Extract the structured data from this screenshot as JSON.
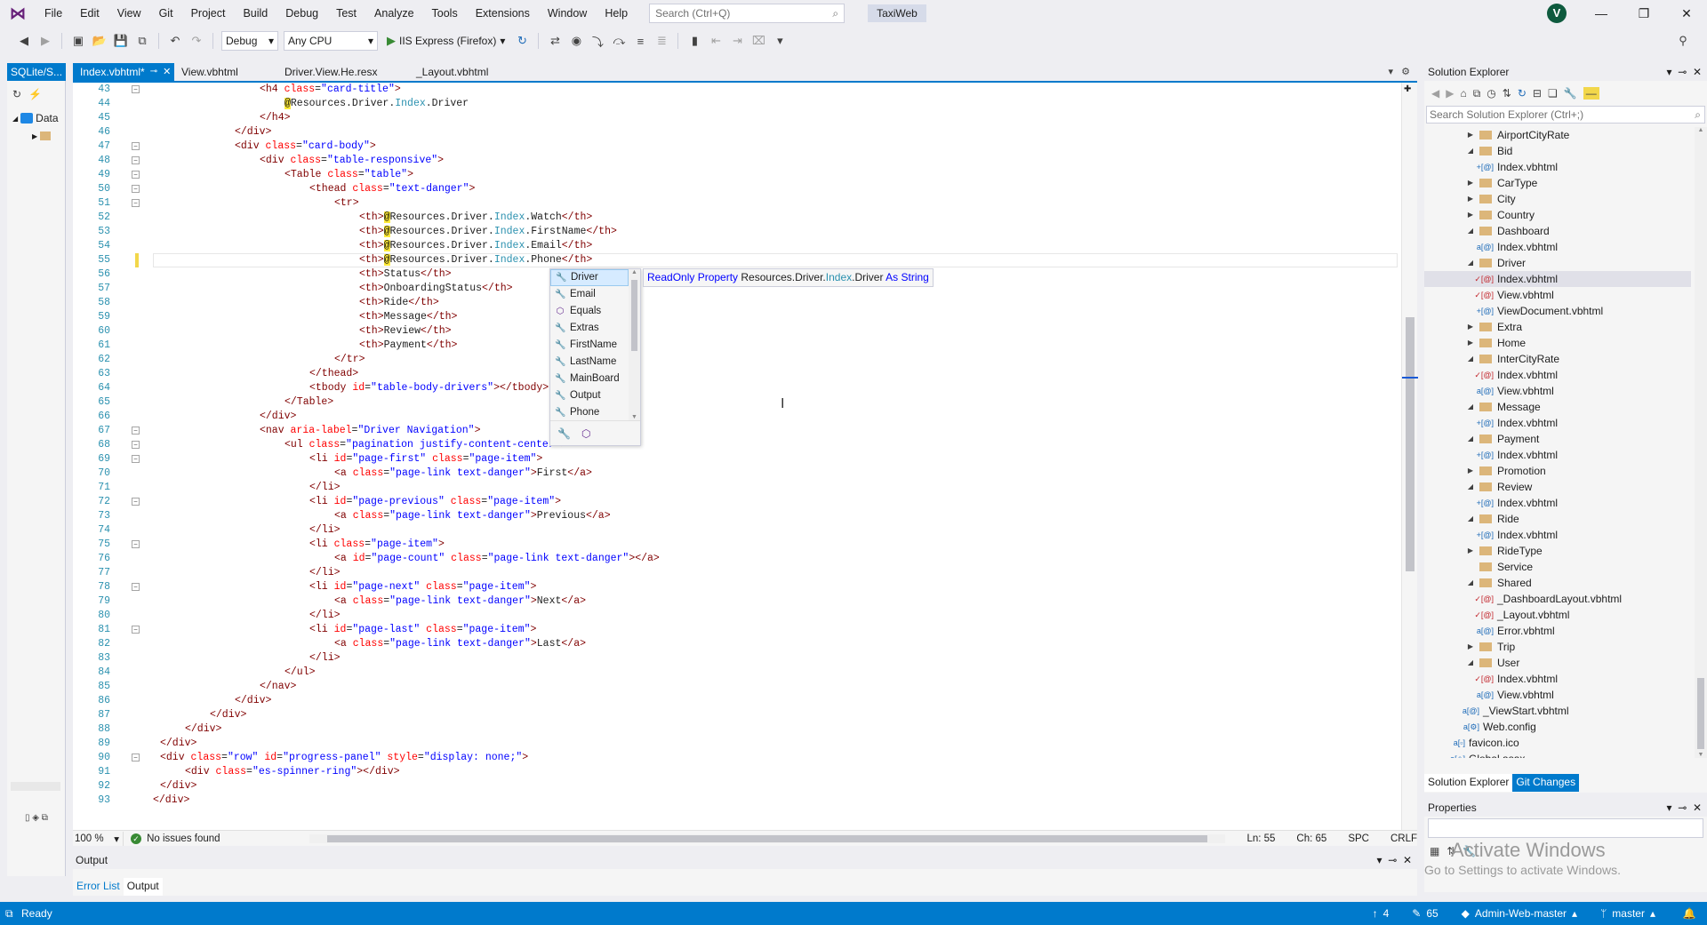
{
  "menu": {
    "items": [
      "File",
      "Edit",
      "View",
      "Git",
      "Project",
      "Build",
      "Debug",
      "Test",
      "Analyze",
      "Tools",
      "Extensions",
      "Window",
      "Help"
    ],
    "search_placeholder": "Search (Ctrl+Q)",
    "solution_name": "TaxiWeb",
    "avatar_initial": "V"
  },
  "toolbar": {
    "config": "Debug",
    "platform": "Any CPU",
    "run_target": "IIS Express (Firefox)"
  },
  "left_panel": {
    "tab": "SQLite/S...",
    "tree_root": "Data"
  },
  "tabs": [
    {
      "label": "Index.vbhtml*",
      "active": true
    },
    {
      "label": "View.vbhtml",
      "active": false
    },
    {
      "label": "Driver.View.He.resx",
      "active": false
    },
    {
      "label": "_Layout.vbhtml",
      "active": false
    }
  ],
  "code": {
    "lines": [
      {
        "n": "43",
        "ind": 5,
        "html": "<span class='t'>&lt;h4</span> <span class='a'>class</span>=<span class='v'>\"card-title\"</span><span class='t'>&gt;</span>"
      },
      {
        "n": "44",
        "ind": 6,
        "html": "<span class='at'>@</span>Resources.Driver.<span class='cls'>Index</span>.Driver"
      },
      {
        "n": "45",
        "ind": 5,
        "html": "<span class='t'>&lt;/h4&gt;</span>"
      },
      {
        "n": "46",
        "ind": 4,
        "html": "<span class='t'>&lt;/div&gt;</span>"
      },
      {
        "n": "47",
        "ind": 4,
        "html": "<span class='t'>&lt;div</span> <span class='a'>class</span>=<span class='v'>\"card-body\"</span><span class='t'>&gt;</span>"
      },
      {
        "n": "48",
        "ind": 5,
        "html": "<span class='t'>&lt;div</span> <span class='a'>class</span>=<span class='v'>\"table-responsive\"</span><span class='t'>&gt;</span>"
      },
      {
        "n": "49",
        "ind": 6,
        "html": "<span class='t'>&lt;Table</span> <span class='a'>class</span>=<span class='v'>\"table\"</span><span class='t'>&gt;</span>"
      },
      {
        "n": "50",
        "ind": 7,
        "html": "<span class='t'>&lt;thead</span> <span class='a'>class</span>=<span class='v'>\"text-danger\"</span><span class='t'>&gt;</span>"
      },
      {
        "n": "51",
        "ind": 8,
        "html": "<span class='t'>&lt;tr&gt;</span>"
      },
      {
        "n": "52",
        "ind": 9,
        "html": "<span class='t'>&lt;th&gt;</span><span class='at'>@</span>Resources.Driver.<span class='cls'>Index</span>.Watch<span class='t'>&lt;/th&gt;</span>"
      },
      {
        "n": "53",
        "ind": 9,
        "html": "<span class='t'>&lt;th&gt;</span><span class='at'>@</span>Resources.Driver.<span class='cls'>Index</span>.FirstName<span class='t'>&lt;/th&gt;</span>"
      },
      {
        "n": "54",
        "ind": 9,
        "html": "<span class='t'>&lt;th&gt;</span><span class='at'>@</span>Resources.Driver.<span class='cls'>Index</span>.Email<span class='t'>&lt;/th&gt;</span>"
      },
      {
        "n": "55",
        "ind": 9,
        "html": "<span class='t'>&lt;th&gt;</span><span class='at'>@</span>Resources.Driver.<span class='cls'>Index</span>.Phone<span class='t'>&lt;/th&gt;</span>"
      },
      {
        "n": "56",
        "ind": 9,
        "html": "<span class='t'>&lt;th&gt;</span>Status<span class='t'>&lt;/th&gt;</span>"
      },
      {
        "n": "57",
        "ind": 9,
        "html": "<span class='t'>&lt;th&gt;</span>OnboardingStatus<span class='t'>&lt;/th&gt;</span>"
      },
      {
        "n": "58",
        "ind": 9,
        "html": "<span class='t'>&lt;th&gt;</span>Ride<span class='t'>&lt;/th&gt;</span>"
      },
      {
        "n": "59",
        "ind": 9,
        "html": "<span class='t'>&lt;th&gt;</span>Message<span class='t'>&lt;/th&gt;</span>"
      },
      {
        "n": "60",
        "ind": 9,
        "html": "<span class='t'>&lt;th&gt;</span>Review<span class='t'>&lt;/th&gt;</span>"
      },
      {
        "n": "61",
        "ind": 9,
        "html": "<span class='t'>&lt;th&gt;</span>Payment<span class='t'>&lt;/th&gt;</span>"
      },
      {
        "n": "62",
        "ind": 8,
        "html": "<span class='t'>&lt;/tr&gt;</span>"
      },
      {
        "n": "63",
        "ind": 7,
        "html": "<span class='t'>&lt;/thead&gt;</span>"
      },
      {
        "n": "64",
        "ind": 7,
        "html": "<span class='t'>&lt;tbody</span> <span class='a'>id</span>=<span class='v'>\"table-body-drivers\"</span><span class='t'>&gt;&lt;/tbody&gt;</span>"
      },
      {
        "n": "65",
        "ind": 6,
        "html": "<span class='t'>&lt;/Table&gt;</span>"
      },
      {
        "n": "66",
        "ind": 5,
        "html": "<span class='t'>&lt;/div&gt;</span>"
      },
      {
        "n": "67",
        "ind": 5,
        "html": "<span class='t'>&lt;nav</span> <span class='a'>aria-label</span>=<span class='v'>\"Driver Navigation\"</span><span class='t'>&gt;</span>"
      },
      {
        "n": "68",
        "ind": 6,
        "html": "<span class='t'>&lt;ul</span> <span class='a'>class</span>=<span class='v'>\"pagination justify-content-center\"</span><span class='t'>&gt;</span>"
      },
      {
        "n": "69",
        "ind": 7,
        "html": "<span class='t'>&lt;li</span> <span class='a'>id</span>=<span class='v'>\"page-first\"</span> <span class='a'>class</span>=<span class='v'>\"page-item\"</span><span class='t'>&gt;</span>"
      },
      {
        "n": "70",
        "ind": 8,
        "html": "<span class='t'>&lt;a</span> <span class='a'>class</span>=<span class='v'>\"page-link text-danger\"</span><span class='t'>&gt;</span>First<span class='t'>&lt;/a&gt;</span>"
      },
      {
        "n": "71",
        "ind": 7,
        "html": "<span class='t'>&lt;/li&gt;</span>"
      },
      {
        "n": "72",
        "ind": 7,
        "html": "<span class='t'>&lt;li</span> <span class='a'>id</span>=<span class='v'>\"page-previous\"</span> <span class='a'>class</span>=<span class='v'>\"page-item\"</span><span class='t'>&gt;</span>"
      },
      {
        "n": "73",
        "ind": 8,
        "html": "<span class='t'>&lt;a</span> <span class='a'>class</span>=<span class='v'>\"page-link text-danger\"</span><span class='t'>&gt;</span>Previous<span class='t'>&lt;/a&gt;</span>"
      },
      {
        "n": "74",
        "ind": 7,
        "html": "<span class='t'>&lt;/li&gt;</span>"
      },
      {
        "n": "75",
        "ind": 7,
        "html": "<span class='t'>&lt;li</span> <span class='a'>class</span>=<span class='v'>\"page-item\"</span><span class='t'>&gt;</span>"
      },
      {
        "n": "76",
        "ind": 8,
        "html": "<span class='t'>&lt;a</span> <span class='a'>id</span>=<span class='v'>\"page-count\"</span> <span class='a'>class</span>=<span class='v'>\"page-link text-danger\"</span><span class='t'>&gt;&lt;/a&gt;</span>"
      },
      {
        "n": "77",
        "ind": 7,
        "html": "<span class='t'>&lt;/li&gt;</span>"
      },
      {
        "n": "78",
        "ind": 7,
        "html": "<span class='t'>&lt;li</span> <span class='a'>id</span>=<span class='v'>\"page-next\"</span> <span class='a'>class</span>=<span class='v'>\"page-item\"</span><span class='t'>&gt;</span>"
      },
      {
        "n": "79",
        "ind": 8,
        "html": "<span class='t'>&lt;a</span> <span class='a'>class</span>=<span class='v'>\"page-link text-danger\"</span><span class='t'>&gt;</span>Next<span class='t'>&lt;/a&gt;</span>"
      },
      {
        "n": "80",
        "ind": 7,
        "html": "<span class='t'>&lt;/li&gt;</span>"
      },
      {
        "n": "81",
        "ind": 7,
        "html": "<span class='t'>&lt;li</span> <span class='a'>id</span>=<span class='v'>\"page-last\"</span> <span class='a'>class</span>=<span class='v'>\"page-item\"</span><span class='t'>&gt;</span>"
      },
      {
        "n": "82",
        "ind": 8,
        "html": "<span class='t'>&lt;a</span> <span class='a'>class</span>=<span class='v'>\"page-link text-danger\"</span><span class='t'>&gt;</span>Last<span class='t'>&lt;/a&gt;</span>"
      },
      {
        "n": "83",
        "ind": 7,
        "html": "<span class='t'>&lt;/li&gt;</span>"
      },
      {
        "n": "84",
        "ind": 6,
        "html": "<span class='t'>&lt;/ul&gt;</span>"
      },
      {
        "n": "85",
        "ind": 5,
        "html": "<span class='t'>&lt;/nav&gt;</span>"
      },
      {
        "n": "86",
        "ind": 4,
        "html": "<span class='t'>&lt;/div&gt;</span>"
      },
      {
        "n": "87",
        "ind": 3,
        "html": "<span class='t'>&lt;/div&gt;</span>"
      },
      {
        "n": "88",
        "ind": 2,
        "html": "<span class='t'>&lt;/div&gt;</span>"
      },
      {
        "n": "89",
        "ind": 1,
        "html": "<span class='t'>&lt;/div&gt;</span>"
      },
      {
        "n": "90",
        "ind": 1,
        "html": "<span class='t'>&lt;div</span> <span class='a'>class</span>=<span class='v'>\"row\"</span> <span class='a'>id</span>=<span class='v'>\"progress-panel\"</span> <span class='a'>style</span>=<span class='v'>\"display: none;\"</span><span class='t'>&gt;</span>"
      },
      {
        "n": "91",
        "ind": 2,
        "html": "<span class='t'>&lt;div</span> <span class='a'>class</span>=<span class='v'>\"es-spinner-ring\"</span><span class='t'>&gt;&lt;/div&gt;</span>"
      },
      {
        "n": "92",
        "ind": 1,
        "html": "<span class='t'>&lt;/div&gt;</span>"
      },
      {
        "n": "93",
        "ind": 0,
        "html": "<span class='t'>&lt;/div&gt;</span>"
      }
    ],
    "fold_lines": [
      "43",
      "47",
      "48",
      "49",
      "50",
      "51",
      "67",
      "68",
      "69",
      "72",
      "75",
      "78",
      "81",
      "90"
    ]
  },
  "completion": {
    "items": [
      "Driver",
      "Email",
      "Equals",
      "Extras",
      "FirstName",
      "LastName",
      "MainBoard",
      "Output",
      "Phone"
    ],
    "selected": "Driver",
    "tooltip_kw": "ReadOnly Property",
    "tooltip_pre": "Resources.Driver.",
    "tooltip_cls": "Index",
    "tooltip_post": ".Driver",
    "tooltip_as": "As",
    "tooltip_type": "String"
  },
  "editor_status": {
    "zoom": "100 %",
    "issues": "No issues found",
    "line": "Ln: 55",
    "col": "Ch: 65",
    "spc": "SPC",
    "eol": "CRLF"
  },
  "output": {
    "title": "Output",
    "tabs": [
      "Error List",
      "Output"
    ]
  },
  "solution_explorer": {
    "title": "Solution Explorer",
    "search_placeholder": "Search Solution Explorer (Ctrl+;)",
    "tabs": [
      "Solution Explorer",
      "Git Changes"
    ],
    "tree": [
      {
        "label": "AirportCityRate",
        "kind": "folder",
        "level": 0,
        "exp": "▶"
      },
      {
        "label": "Bid",
        "kind": "folder",
        "level": 0,
        "exp": "◢"
      },
      {
        "label": "Index.vbhtml",
        "kind": "file",
        "level": 1,
        "mark": "+[@]"
      },
      {
        "label": "CarType",
        "kind": "folder",
        "level": 0,
        "exp": "▶"
      },
      {
        "label": "City",
        "kind": "folder",
        "level": 0,
        "exp": "▶"
      },
      {
        "label": "Country",
        "kind": "folder",
        "level": 0,
        "exp": "▶"
      },
      {
        "label": "Dashboard",
        "kind": "folder",
        "level": 0,
        "exp": "◢"
      },
      {
        "label": "Index.vbhtml",
        "kind": "file",
        "level": 1,
        "mark": "a[@]"
      },
      {
        "label": "Driver",
        "kind": "folder",
        "level": 0,
        "exp": "◢"
      },
      {
        "label": "Index.vbhtml",
        "kind": "file",
        "level": 1,
        "mark": "✓[@]",
        "mod": true,
        "sel": true
      },
      {
        "label": "View.vbhtml",
        "kind": "file",
        "level": 1,
        "mark": "✓[@]",
        "mod": true
      },
      {
        "label": "ViewDocument.vbhtml",
        "kind": "file",
        "level": 1,
        "mark": "+[@]"
      },
      {
        "label": "Extra",
        "kind": "folder",
        "level": 0,
        "exp": "▶"
      },
      {
        "label": "Home",
        "kind": "folder",
        "level": 0,
        "exp": "▶"
      },
      {
        "label": "InterCityRate",
        "kind": "folder",
        "level": 0,
        "exp": "◢"
      },
      {
        "label": "Index.vbhtml",
        "kind": "file",
        "level": 1,
        "mark": "✓[@]",
        "mod": true
      },
      {
        "label": "View.vbhtml",
        "kind": "file",
        "level": 1,
        "mark": "a[@]"
      },
      {
        "label": "Message",
        "kind": "folder",
        "level": 0,
        "exp": "◢"
      },
      {
        "label": "Index.vbhtml",
        "kind": "file",
        "level": 1,
        "mark": "+[@]"
      },
      {
        "label": "Payment",
        "kind": "folder",
        "level": 0,
        "exp": "◢"
      },
      {
        "label": "Index.vbhtml",
        "kind": "file",
        "level": 1,
        "mark": "+[@]"
      },
      {
        "label": "Promotion",
        "kind": "folder",
        "level": 0,
        "exp": "▶"
      },
      {
        "label": "Review",
        "kind": "folder",
        "level": 0,
        "exp": "◢"
      },
      {
        "label": "Index.vbhtml",
        "kind": "file",
        "level": 1,
        "mark": "+[@]"
      },
      {
        "label": "Ride",
        "kind": "folder",
        "level": 0,
        "exp": "◢"
      },
      {
        "label": "Index.vbhtml",
        "kind": "file",
        "level": 1,
        "mark": "+[@]"
      },
      {
        "label": "RideType",
        "kind": "folder",
        "level": 0,
        "exp": "▶"
      },
      {
        "label": "Service",
        "kind": "folder",
        "level": 0,
        "exp": ""
      },
      {
        "label": "Shared",
        "kind": "folder",
        "level": 0,
        "exp": "◢"
      },
      {
        "label": "_DashboardLayout.vbhtml",
        "kind": "file",
        "level": 1,
        "mark": "✓[@]",
        "mod": true
      },
      {
        "label": "_Layout.vbhtml",
        "kind": "file",
        "level": 1,
        "mark": "✓[@]",
        "mod": true
      },
      {
        "label": "Error.vbhtml",
        "kind": "file",
        "level": 1,
        "mark": "a[@]"
      },
      {
        "label": "Trip",
        "kind": "folder",
        "level": 0,
        "exp": "▶"
      },
      {
        "label": "User",
        "kind": "folder",
        "level": 0,
        "exp": "◢"
      },
      {
        "label": "Index.vbhtml",
        "kind": "file",
        "level": 1,
        "mark": "✓[@]",
        "mod": true
      },
      {
        "label": "View.vbhtml",
        "kind": "file",
        "level": 1,
        "mark": "a[@]"
      },
      {
        "label": "_ViewStart.vbhtml",
        "kind": "file",
        "level": 0,
        "mark": "a[@]"
      },
      {
        "label": "Web.config",
        "kind": "file",
        "level": 0,
        "mark": "a[⚙]"
      },
      {
        "label": "favicon.ico",
        "kind": "file",
        "level": -1,
        "mark": "a[▫]"
      },
      {
        "label": "Global.asax",
        "kind": "file",
        "level": -1,
        "mark": "a[◇]"
      }
    ]
  },
  "properties": {
    "title": "Properties",
    "watermark_1": "Activate Windows",
    "watermark_2": "Go to Settings to activate Windows."
  },
  "status": {
    "ready": "Ready",
    "up_count": "4",
    "pending": "65",
    "repo": "Admin-Web-master",
    "branch": "master"
  }
}
